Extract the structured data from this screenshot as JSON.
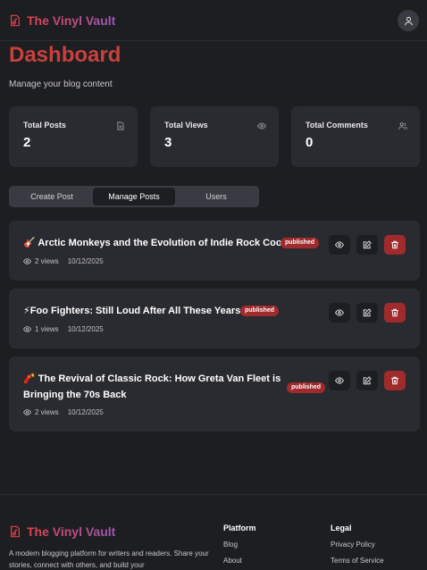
{
  "header": {
    "brand": "The Vinyl Vault"
  },
  "page": {
    "title": "Dashboard",
    "subtitle": "Manage your blog content"
  },
  "stats": [
    {
      "label": "Total Posts",
      "value": "2",
      "icon": "document-icon"
    },
    {
      "label": "Total Views",
      "value": "3",
      "icon": "eye-icon"
    },
    {
      "label": "Total Comments",
      "value": "0",
      "icon": "users-icon"
    }
  ],
  "tabs": [
    {
      "label": "Create Post",
      "active": false
    },
    {
      "label": "Manage Posts",
      "active": true
    },
    {
      "label": "Users",
      "active": false
    }
  ],
  "posts": [
    {
      "title": "🎸 Arctic Monkeys and the Evolution of Indie Rock Cool",
      "status": "published",
      "views": "2 views",
      "date": "10/12/2025"
    },
    {
      "title": "⚡Foo Fighters: Still Loud After All These Years",
      "status": "published",
      "views": "1 views",
      "date": "10/12/2025"
    },
    {
      "title_line1": "🧨 The Revival of Classic Rock: How Greta Van Fleet is",
      "title_line2": "Bringing the 70s Back",
      "status": "published",
      "views": "2 views",
      "date": "10/12/2025"
    }
  ],
  "footer": {
    "brand": "The Vinyl Vault",
    "description": "A modern blogging platform for writers and readers. Share your stories, connect with others, and build your",
    "platform": {
      "heading": "Platform",
      "links": [
        "Blog",
        "About"
      ]
    },
    "legal": {
      "heading": "Legal",
      "links": [
        "Privacy Policy",
        "Terms of Service"
      ]
    }
  },
  "colors": {
    "accent": "#c9413c",
    "danger": "#a12a2d",
    "background": "#1d1e22",
    "card": "#2a2b31"
  }
}
